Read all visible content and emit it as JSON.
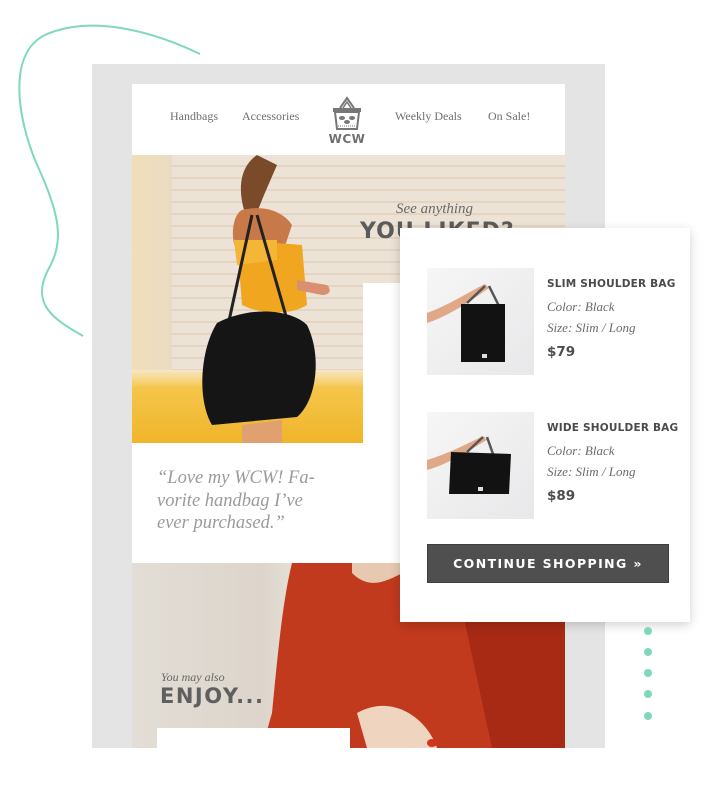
{
  "brand": {
    "name": "WCW",
    "accent_color": "#7ed9bb"
  },
  "nav": {
    "items": [
      {
        "label": "Handbags"
      },
      {
        "label": "Accessories"
      },
      {
        "label": "Weekly Deals"
      },
      {
        "label": "On Sale!"
      }
    ],
    "logo_icon": "shopping-basket-icon"
  },
  "hero": {
    "kicker": "See anything",
    "title": "YOU LIKED?"
  },
  "testimonial": {
    "quote": "“Love my WCW! Fa-vorite handbag I’ve ever purchased.”"
  },
  "recommendations": {
    "kicker": "You may also",
    "title": "ENJOY..."
  },
  "cart_popup": {
    "products": [
      {
        "name": "SLIM SHOULDER BAG",
        "color": "Color: Black",
        "size": "Size: Slim / Long",
        "price": "$79"
      },
      {
        "name": "WIDE SHOULDER BAG",
        "color": "Color: Black",
        "size": "Size: Slim / Long",
        "price": "$89"
      }
    ],
    "cta_label": "CONTINUE SHOPPING »"
  }
}
